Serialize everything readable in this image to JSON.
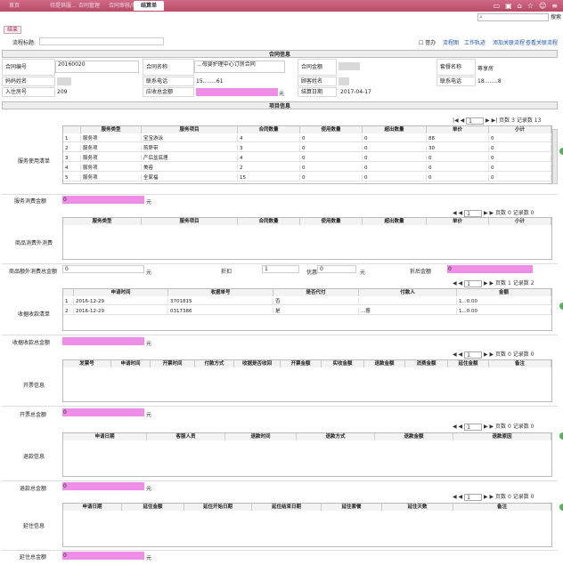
{
  "tabs": [
    "首页",
    "待提供服...",
    "合同管理",
    "合同审核/审批",
    "结算单"
  ],
  "active_tab": "结算单",
  "search": {
    "placeholder": "",
    "button": "搜索"
  },
  "toolbar": {
    "button": "结束"
  },
  "flow": {
    "label": "流程标题:",
    "value": "",
    "notify": "督办",
    "links": [
      "流程图",
      "工作轨迹",
      "添加关联流程",
      "查看关联流程"
    ]
  },
  "contract": {
    "header": "合同信息",
    "contract_no_label": "合同编号",
    "contract_no": "20160020",
    "contract_name_label": "合同名称",
    "contract_name": "...母婴护理中心订房合同",
    "contract_amount_label": "合同金额",
    "contract_amount": "",
    "package_label": "套餐名称",
    "package": "尊享房",
    "client_label": "妈妈姓名",
    "client": "",
    "phone_label": "联系电话",
    "phone": "15........61",
    "advisor_label": "顾客姓名",
    "advisor": "",
    "advisor_phone_label": "联系电话",
    "advisor_phone": "18........8",
    "room_label": "入住房号",
    "room": "209",
    "receivable_label": "应收总金额",
    "receivable_suffix": "元",
    "settle_date_label": "结算日期",
    "settle_date": "2017-04-17"
  },
  "project_header": "项目信息",
  "service": {
    "side_label": "服务使用清单",
    "pager": {
      "page": "1",
      "pages_label": "页数",
      "pages": "3",
      "records_label": "记录数",
      "records": "13"
    },
    "columns": [
      "",
      "服务类型",
      "服务项目",
      "合同数量",
      "使用数量",
      "超出数量",
      "单价",
      "小计"
    ],
    "rows": [
      [
        "1",
        "服务项",
        "宝宝游泳",
        "4",
        "0",
        "0",
        "88",
        "0"
      ],
      [
        "2",
        "服务项",
        "剪脐带",
        "3",
        "0",
        "0",
        "30",
        "0"
      ],
      [
        "3",
        "服务项",
        "产后盆底理",
        "4",
        "0",
        "0",
        "0",
        "0"
      ],
      [
        "4",
        "服务项",
        "美容",
        "2",
        "0",
        "0",
        "0",
        "0"
      ],
      [
        "5",
        "服务项",
        "全家福",
        "15",
        "0",
        "0",
        "0",
        "0"
      ]
    ],
    "total_label": "服务消费金额",
    "total_value": "0",
    "total_suffix": "元"
  },
  "goods": {
    "side_label": "商品消费外消费",
    "pager": {
      "page": "1",
      "pages_label": "页数",
      "pages": "0",
      "records_label": "记录数",
      "records": "0"
    },
    "columns": [
      "服务类型",
      "服务项目",
      "合同数量",
      "使用数量",
      "超出数量",
      "单价",
      "小计"
    ],
    "total_label": "商品额外消费总金额",
    "total_value": "0",
    "yuan": "元",
    "discount_label": "折扣",
    "discount_value": "1",
    "off_label": "优惠",
    "off_value": "0",
    "after_label": "折后金额",
    "after_value": "0"
  },
  "receipts": {
    "side_label": "收据收款清单",
    "pager": {
      "page": "1",
      "pages_label": "页数",
      "pages": "1",
      "records_label": "记录数",
      "records": "2"
    },
    "columns": [
      "",
      "申请时间",
      "收据单号",
      "是否代付",
      "付款人",
      "金额"
    ],
    "rows": [
      [
        "1",
        "2016-12-29",
        "3701815",
        "否",
        "",
        "1...0.00"
      ],
      [
        "2",
        "2016-12-29",
        "0317386",
        "是",
        "...蓉",
        "1...0.00"
      ]
    ],
    "total_label": "收据收款总金额",
    "total_suffix": "元"
  },
  "invoice": {
    "side_label": "开票信息",
    "pager": {
      "page": "1",
      "pages_label": "页数",
      "pages": "0",
      "records_label": "记录数",
      "records": "0"
    },
    "columns": [
      "发票号",
      "申请时间",
      "开票时间",
      "付款方式",
      "收据是否收回",
      "开票金额",
      "实收金额",
      "退款金额",
      "消费金额",
      "延住金额",
      "备注"
    ],
    "total_label": "开票总金额",
    "total_value": "0",
    "total_suffix": "元"
  },
  "refund": {
    "side_label": "退款信息",
    "pager": {
      "page": "1",
      "pages_label": "页数",
      "pages": "0",
      "records_label": "记录数",
      "records": "0"
    },
    "columns": [
      "申请日期",
      "客服人员",
      "退款时间",
      "退款方式",
      "退款金额",
      "退款原因"
    ],
    "total_label": "退款总金额",
    "total_value": "0",
    "total_suffix": "元"
  },
  "extend": {
    "side_label": "延住信息",
    "pager": {
      "page": "1",
      "pages_label": "页数",
      "pages": "0",
      "records_label": "记录数",
      "records": "0"
    },
    "columns": [
      "申请日期",
      "延住金额",
      "延住开始日期",
      "延住结束日期",
      "延住套餐",
      "延住天数",
      "备注"
    ],
    "total_label": "延住总金额",
    "total_value": "0",
    "total_suffix": "元"
  },
  "colors": {
    "header": "#c25a76",
    "highlight": "#ef8ee6",
    "link": "#1b52a8"
  }
}
